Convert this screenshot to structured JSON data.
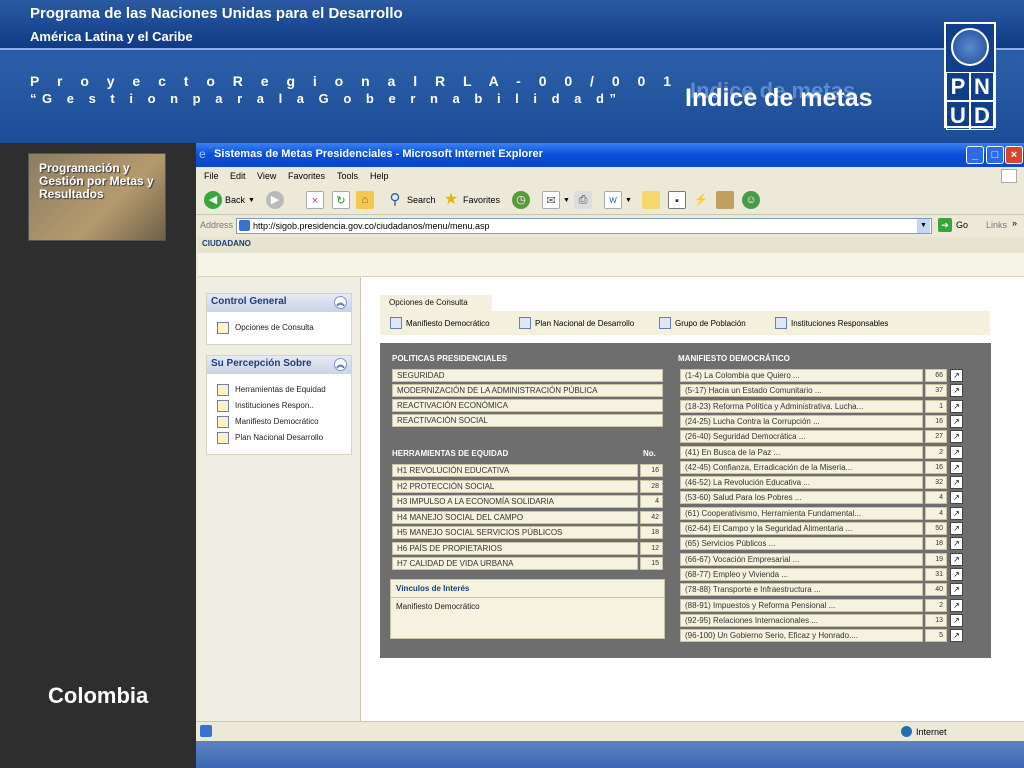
{
  "header": {
    "org": "Programa de las  Naciones Unidas para el  Desarrollo",
    "region": "América Latina y el Caribe",
    "project": "P r o y e c t o   R e g i o n a l  R L A - 0 0 / 0 0 1",
    "project_name": "“G e s t i o n   p a r a   l a   G o b e r n a b i l i d a d”",
    "slide_title": "Indice de metas",
    "logo_letters": [
      "P",
      "N",
      "U",
      "D"
    ]
  },
  "sidebar": {
    "thumb_title": "Programación y Gestión por Metas y Resultados",
    "country": "Colombia"
  },
  "browser": {
    "title": "Sistemas de Metas Presidenciales - Microsoft Internet Explorer",
    "menu": [
      "File",
      "Edit",
      "View",
      "Favorites",
      "Tools",
      "Help"
    ],
    "toolbar": {
      "back": "Back",
      "search": "Search",
      "favorites": "Favorites"
    },
    "address_label": "Address",
    "url": "http://sigob.presidencia.gov.co/ciudadanos/menu/menu.asp",
    "go": "Go",
    "links": "Links",
    "status": "Internet"
  },
  "page": {
    "section": "CIUDADANO",
    "control_general": {
      "title": "Control General",
      "items": [
        "Opciones de Consulta"
      ]
    },
    "percepcion": {
      "title": "Su Percepción Sobre",
      "items": [
        "Herramientas de Equidad",
        "Instituciones Respon..",
        "Manifiesto Democrático",
        "Plan Nacional Desarrollo"
      ]
    },
    "tabs": {
      "header": "Opciones de Consulta",
      "items": [
        "Manifiesto Democrático",
        "Plan Nacional de Desarrollo",
        "Grupo de Población",
        "Instituciones Responsables"
      ]
    },
    "politicas": {
      "title": "POLITICAS PRESIDENCIALES",
      "rows": [
        "SEGURIDAD",
        "MODERNIZACIÓN DE LA ADMINISTRACIÓN PÚBLICA",
        "REACTIVACIÓN ECONÓMICA",
        "REACTIVACIÓN SOCIAL"
      ]
    },
    "herramientas": {
      "title": "HERRAMIENTAS DE EQUIDAD",
      "no_label": "No.",
      "rows": [
        {
          "label": "H1 REVOLUCIÓN EDUCATIVA",
          "n": "16"
        },
        {
          "label": "H2 PROTECCIÓN SOCIAL",
          "n": "28"
        },
        {
          "label": "H3 IMPULSO A LA ECONOMÍA SOLIDARIA",
          "n": "4"
        },
        {
          "label": "H4 MANEJO SOCIAL DEL CAMPO",
          "n": "42"
        },
        {
          "label": "H5 MANEJO SOCIAL SERVICIOS PÚBLICOS",
          "n": "18"
        },
        {
          "label": "H6 PAÍS DE PROPIETARIOS",
          "n": "12"
        },
        {
          "label": "H7 CALIDAD DE VIDA URBANA",
          "n": "15"
        }
      ]
    },
    "vinculos": {
      "title": "Vínculos de Interés",
      "item": "Manifiesto Democrático"
    },
    "manifiesto": {
      "title": "MANIFIESTO DEMOCRÁTICO",
      "rows": [
        {
          "label": "(1-4) La Colombia que Quiero ...",
          "n": "66"
        },
        {
          "label": "(5-17) Hacia un Estado Comunitario ...",
          "n": "37"
        },
        {
          "label": "(18-23) Reforma Política y Administrativa. Lucha...",
          "n": "1"
        },
        {
          "label": "(24-25) Lucha Contra la Corrupción ...",
          "n": "16"
        },
        {
          "label": "(26-40) Seguridad Democrática ...",
          "n": "27"
        },
        {
          "label": "(41) En Busca de la Paz ...",
          "n": "2"
        },
        {
          "label": "(42-45) Confianza, Erradicación de la Miseria...",
          "n": "16"
        },
        {
          "label": "(46-52) La Revolución Educativa ...",
          "n": "32"
        },
        {
          "label": "(53-60) Salud Para los Pobres ...",
          "n": "4"
        },
        {
          "label": "(61) Cooperativismo, Herramienta Fundamental...",
          "n": "4"
        },
        {
          "label": "(62-64) El Campo y la Seguridad Alimentaria ...",
          "n": "50"
        },
        {
          "label": "(65) Servicios Públicos ...",
          "n": "18"
        },
        {
          "label": "(66-67) Vocación Empresarial ...",
          "n": "19"
        },
        {
          "label": "(68-77) Empleo y Vivienda ...",
          "n": "31"
        },
        {
          "label": "(78-88) Transporte e Infraestructura ...",
          "n": "40"
        },
        {
          "label": "(88-91) Impuestos y Reforma Pensional ...",
          "n": "2"
        },
        {
          "label": "(92-95) Relaciones Internacionales ...",
          "n": "13"
        },
        {
          "label": "(96-100) Un Gobierno Serio, Eficaz y Honrado....",
          "n": "5"
        }
      ]
    }
  }
}
